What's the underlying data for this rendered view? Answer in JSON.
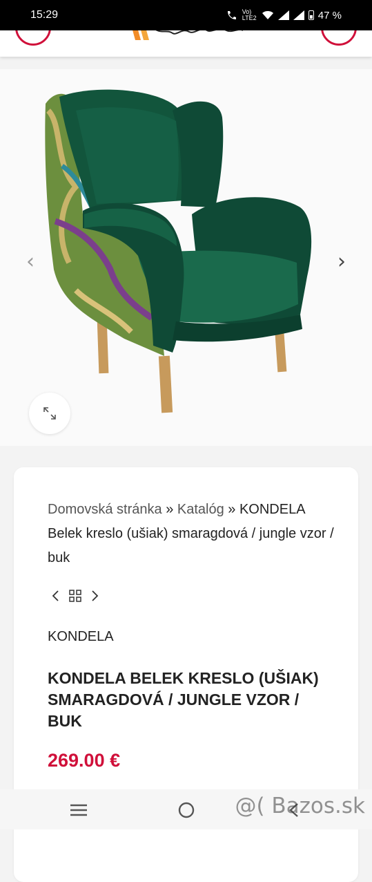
{
  "status_bar": {
    "time": "15:29",
    "volte": "Vo) LTE2",
    "battery": "47 %"
  },
  "gallery": {
    "prev_icon": "chevron-left-icon",
    "next_icon": "chevron-right-icon",
    "zoom_icon": "expand-icon"
  },
  "breadcrumb": {
    "home": "Domovská stránka",
    "separator": "»",
    "catalog": "Katalóg",
    "current": "KONDELA Belek kreslo (ušiak) smaragdová / jungle vzor / buk"
  },
  "product": {
    "brand": "KONDELA",
    "title": "KONDELA BELEK KRESLO (UŠIAK) SMARAGDOVÁ / JUNGLE VZOR / BUK",
    "price": "269.00 €"
  },
  "watermark": "@( Bazos.sk",
  "colors": {
    "accent": "#d0103a",
    "chair_green": "#0f4a36"
  }
}
